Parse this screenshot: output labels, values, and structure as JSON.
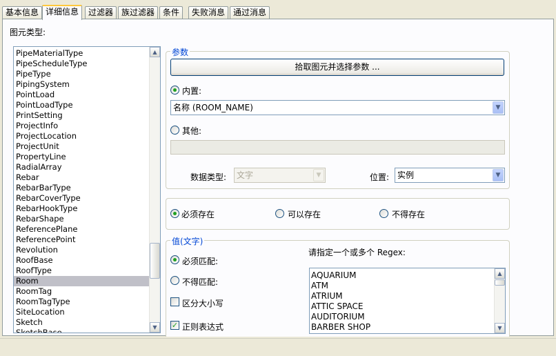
{
  "tabs": [
    "基本信息",
    "详细信息",
    "过滤器",
    "族过滤器",
    "条件",
    "失败消息",
    "通过消息"
  ],
  "active_tab": "详细信息",
  "category_label": "图元类型:",
  "element_types": [
    "PipeMaterialType",
    "PipeScheduleType",
    "PipeType",
    "PipingSystem",
    "PointLoad",
    "PointLoadType",
    "PrintSetting",
    "ProjectInfo",
    "ProjectLocation",
    "ProjectUnit",
    "PropertyLine",
    "RadialArray",
    "Rebar",
    "RebarBarType",
    "RebarCoverType",
    "RebarHookType",
    "RebarShape",
    "ReferencePlane",
    "ReferencePoint",
    "Revolution",
    "RoofBase",
    "RoofType",
    "Room",
    "RoomTag",
    "RoomTagType",
    "SiteLocation",
    "Sketch",
    "SketchBase"
  ],
  "selected_element_type": "Room",
  "params": {
    "group_title": "参数",
    "pick_button": "拾取图元并选择参数 ...",
    "builtin_label": "内置:",
    "builtin_value": "名称 (ROOM_NAME)",
    "other_label": "其他:",
    "other_value": "",
    "data_type_label": "数据类型:",
    "data_type_value": "文字",
    "position_label": "位置:",
    "position_value": "实例"
  },
  "existence": {
    "must": "必须存在",
    "may": "可以存在",
    "must_not": "不得存在",
    "selected": "must"
  },
  "value": {
    "group_title": "值(文字)",
    "must_match": "必须匹配:",
    "must_not_match": "不得匹配:",
    "case_sensitive": "区分大小写",
    "regex_checkbox": "正则表达式",
    "regex_prompt": "请指定一个或多个 Regex:",
    "regex_items": [
      "AQUARIUM",
      "ATM",
      "ATRIUM",
      "ATTIC SPACE",
      "AUDITORIUM",
      "BARBER SHOP"
    ],
    "match_selected": "must_match",
    "case_checked": false,
    "regex_checked": true
  },
  "icons": [
    "up-arrow-icon",
    "down-arrow-icon",
    "dropdown-arrow-icon"
  ]
}
